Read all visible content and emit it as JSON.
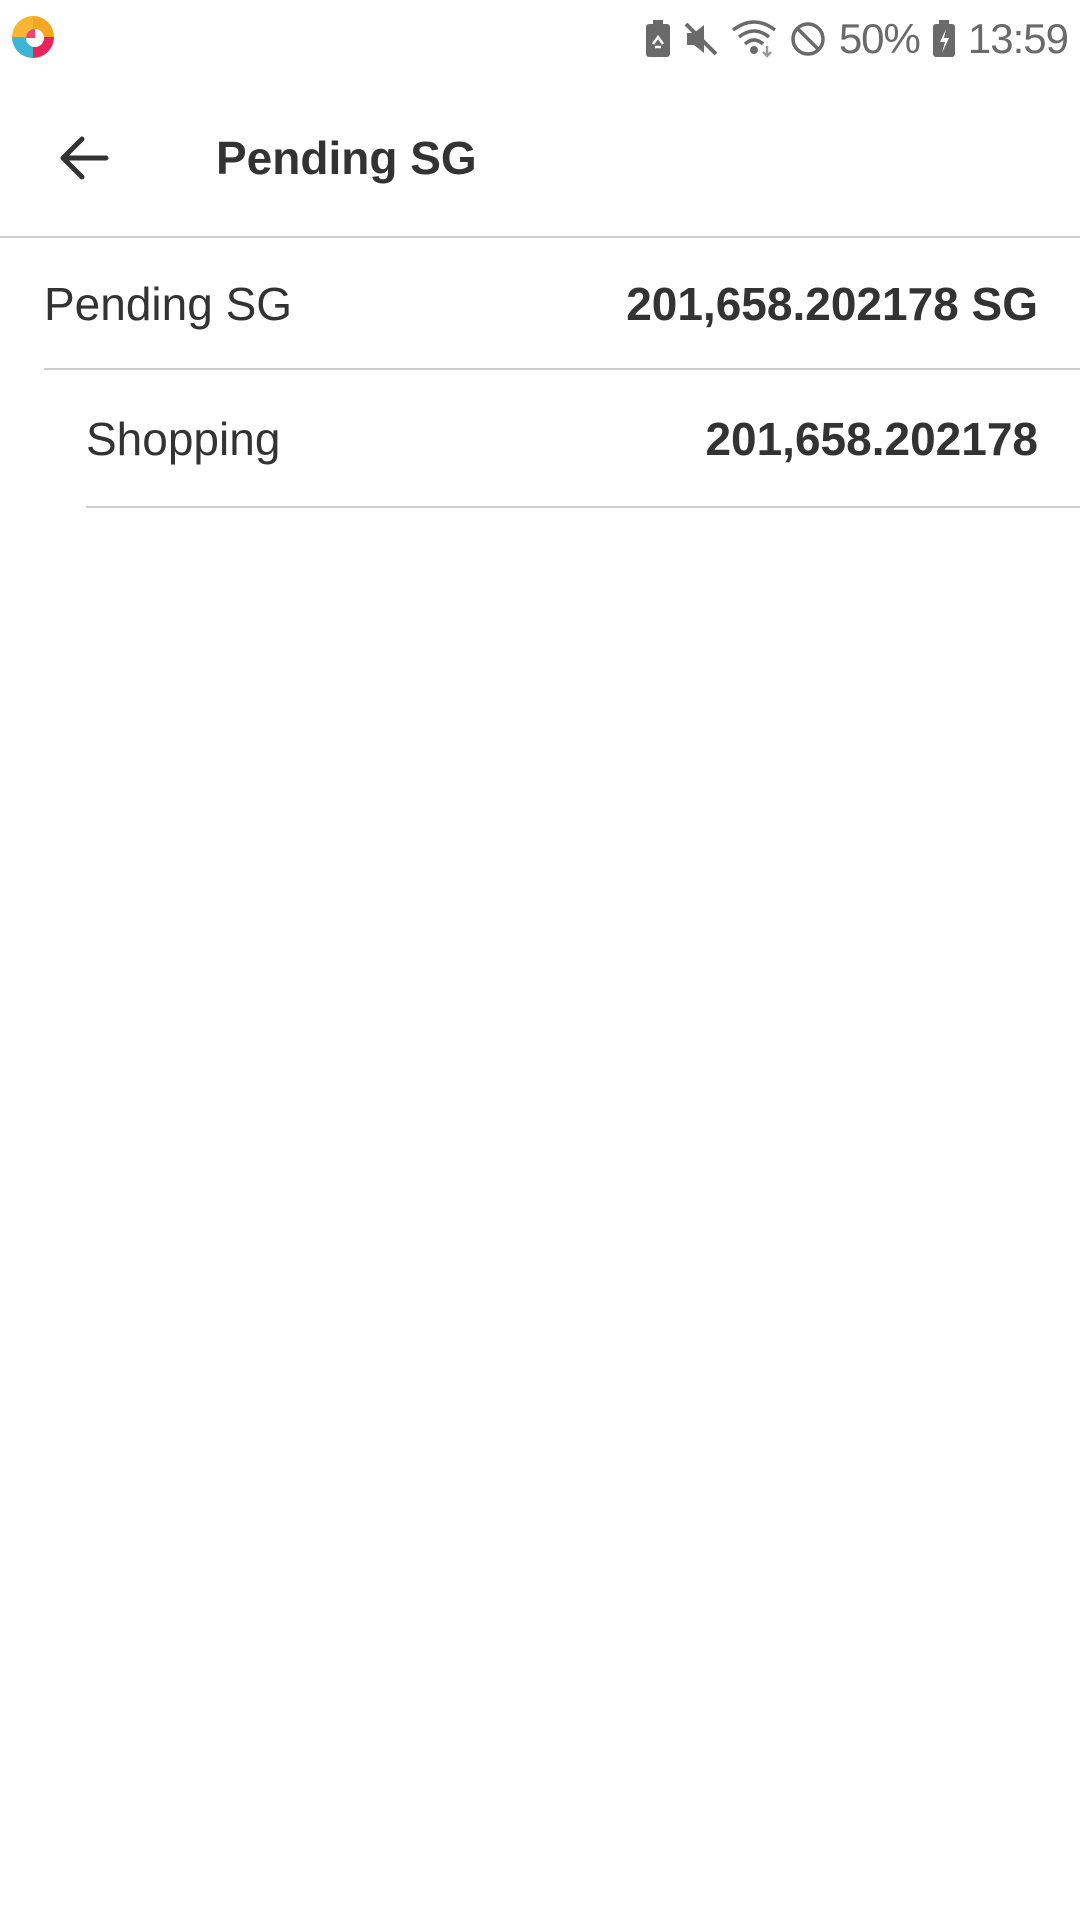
{
  "status_bar": {
    "icons": [
      "app-logo-icon",
      "battery-saver-icon",
      "mute-icon",
      "wifi-icon",
      "do-not-disturb-icon",
      "battery-charging-icon"
    ],
    "battery_percent": "50%",
    "time": "13:59"
  },
  "app_bar": {
    "back_icon": "arrow-left-icon",
    "title": "Pending SG"
  },
  "summary": {
    "label": "Pending SG",
    "value": "201,658.202178 SG"
  },
  "breakdown": [
    {
      "label": "Shopping",
      "value": "201,658.202178"
    }
  ],
  "colors": {
    "text": "#333333",
    "divider": "#cfcfcf",
    "status_icon": "#6a6a6a",
    "background": "#ffffff"
  }
}
